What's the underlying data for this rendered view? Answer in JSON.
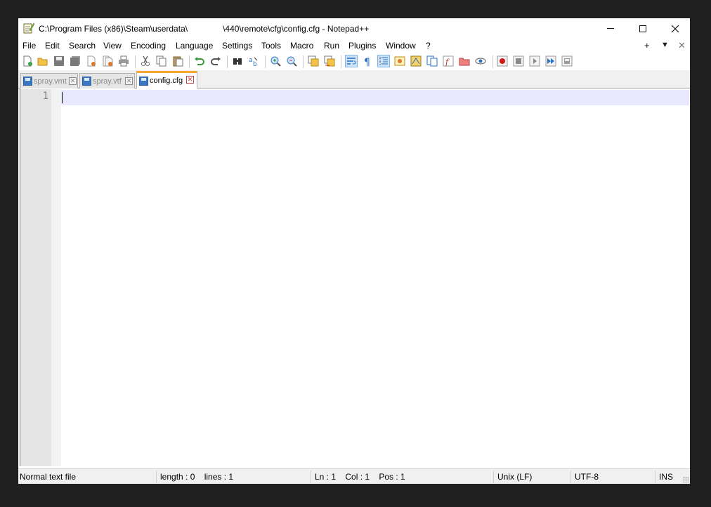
{
  "window": {
    "title": "C:\\Program Files (x86)\\Steam\\userdata\\               \\440\\remote\\cfg\\config.cfg - Notepad++"
  },
  "menu": {
    "items": [
      "File",
      "Edit",
      "Search",
      "View",
      "Encoding",
      "Language",
      "Settings",
      "Tools",
      "Macro",
      "Run",
      "Plugins",
      "Window",
      "?"
    ],
    "right": [
      "+",
      "▼",
      "✕"
    ]
  },
  "tabs": [
    {
      "label": "spray.vmt",
      "active": false
    },
    {
      "label": "spray.vtf",
      "active": false
    },
    {
      "label": "config.cfg",
      "active": true
    }
  ],
  "editor": {
    "line_numbers": [
      "1"
    ]
  },
  "statusbar": {
    "file_type": "Normal text file",
    "length_lines": "length : 0    lines : 1",
    "position": "Ln : 1    Col : 1    Pos : 1",
    "eol": "Unix (LF)",
    "encoding": "UTF-8",
    "mode": "INS"
  },
  "colors": {
    "accent_tab": "#f9a834",
    "current_line": "#e8e8ff",
    "gutter": "#e4e4e4"
  }
}
